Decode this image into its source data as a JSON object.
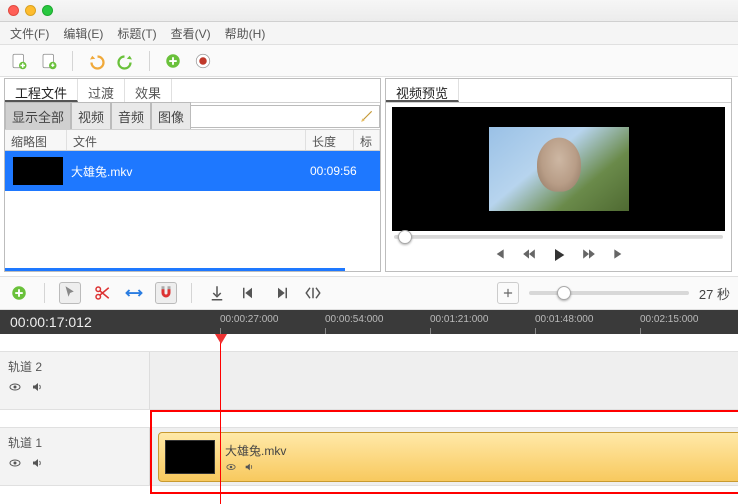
{
  "menubar": [
    "文件(F)",
    "编辑(E)",
    "标题(T)",
    "查看(V)",
    "帮助(H)"
  ],
  "left": {
    "tabs": [
      "工程文件",
      "过渡",
      "效果"
    ],
    "activeTab": 0,
    "filters": [
      "显示全部",
      "视频",
      "音频",
      "图像"
    ],
    "activeFilter": 0,
    "headers": {
      "thumb": "缩略图",
      "file": "文件",
      "len": "长度",
      "tag": "标"
    },
    "rows": [
      {
        "name": "大雄兔.mkv",
        "duration": "00:09:56"
      }
    ]
  },
  "preview": {
    "tab": "视频预览"
  },
  "timeline": {
    "position": "00:00:17:012",
    "zoomLabel": "27 秒",
    "ticks": [
      "00:00:27:000",
      "00:00:54:000",
      "00:01:21:000",
      "00:01:48:000",
      "00:02:15:000"
    ],
    "tracks": [
      {
        "name": "轨道 2"
      },
      {
        "name": "轨道 1",
        "clip": {
          "name": "大雄兔.mkv"
        }
      }
    ]
  }
}
